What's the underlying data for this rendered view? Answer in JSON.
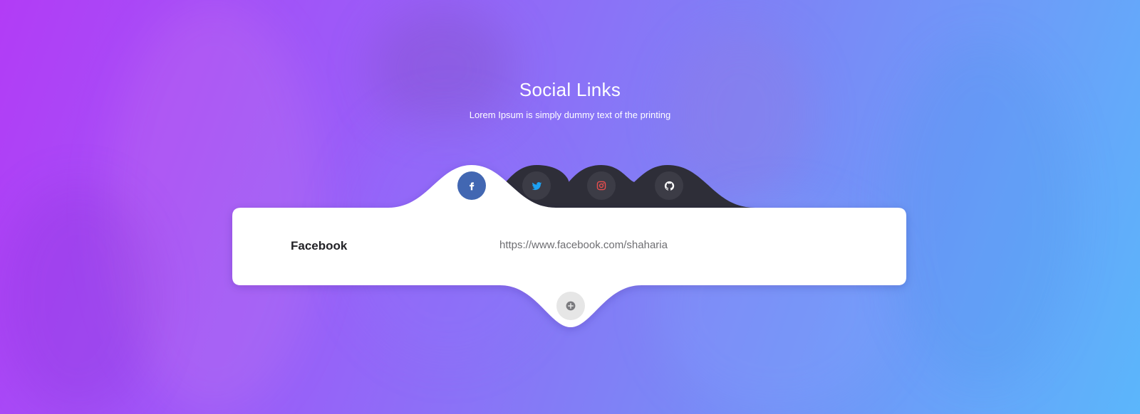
{
  "header": {
    "title": "Social Links",
    "subtitle": "Lorem Ipsum is simply dummy text of the printing"
  },
  "tabs": [
    {
      "icon": "facebook-icon",
      "active": true,
      "color": "#4267b2"
    },
    {
      "icon": "twitter-icon",
      "active": false,
      "color": "#1da1f2"
    },
    {
      "icon": "instagram-icon",
      "active": false,
      "color": "#e94e4e"
    },
    {
      "icon": "github-icon",
      "active": false,
      "color": "#ffffff"
    }
  ],
  "link": {
    "label": "Facebook",
    "value": "https://www.facebook.com/shaharia"
  },
  "add_button": {
    "icon": "plus-circle-icon"
  },
  "colors": {
    "gradient_start": "#b23cf6",
    "gradient_end": "#5bb6fb",
    "card": "#ffffff",
    "dark_tab": "#2e2e38"
  }
}
